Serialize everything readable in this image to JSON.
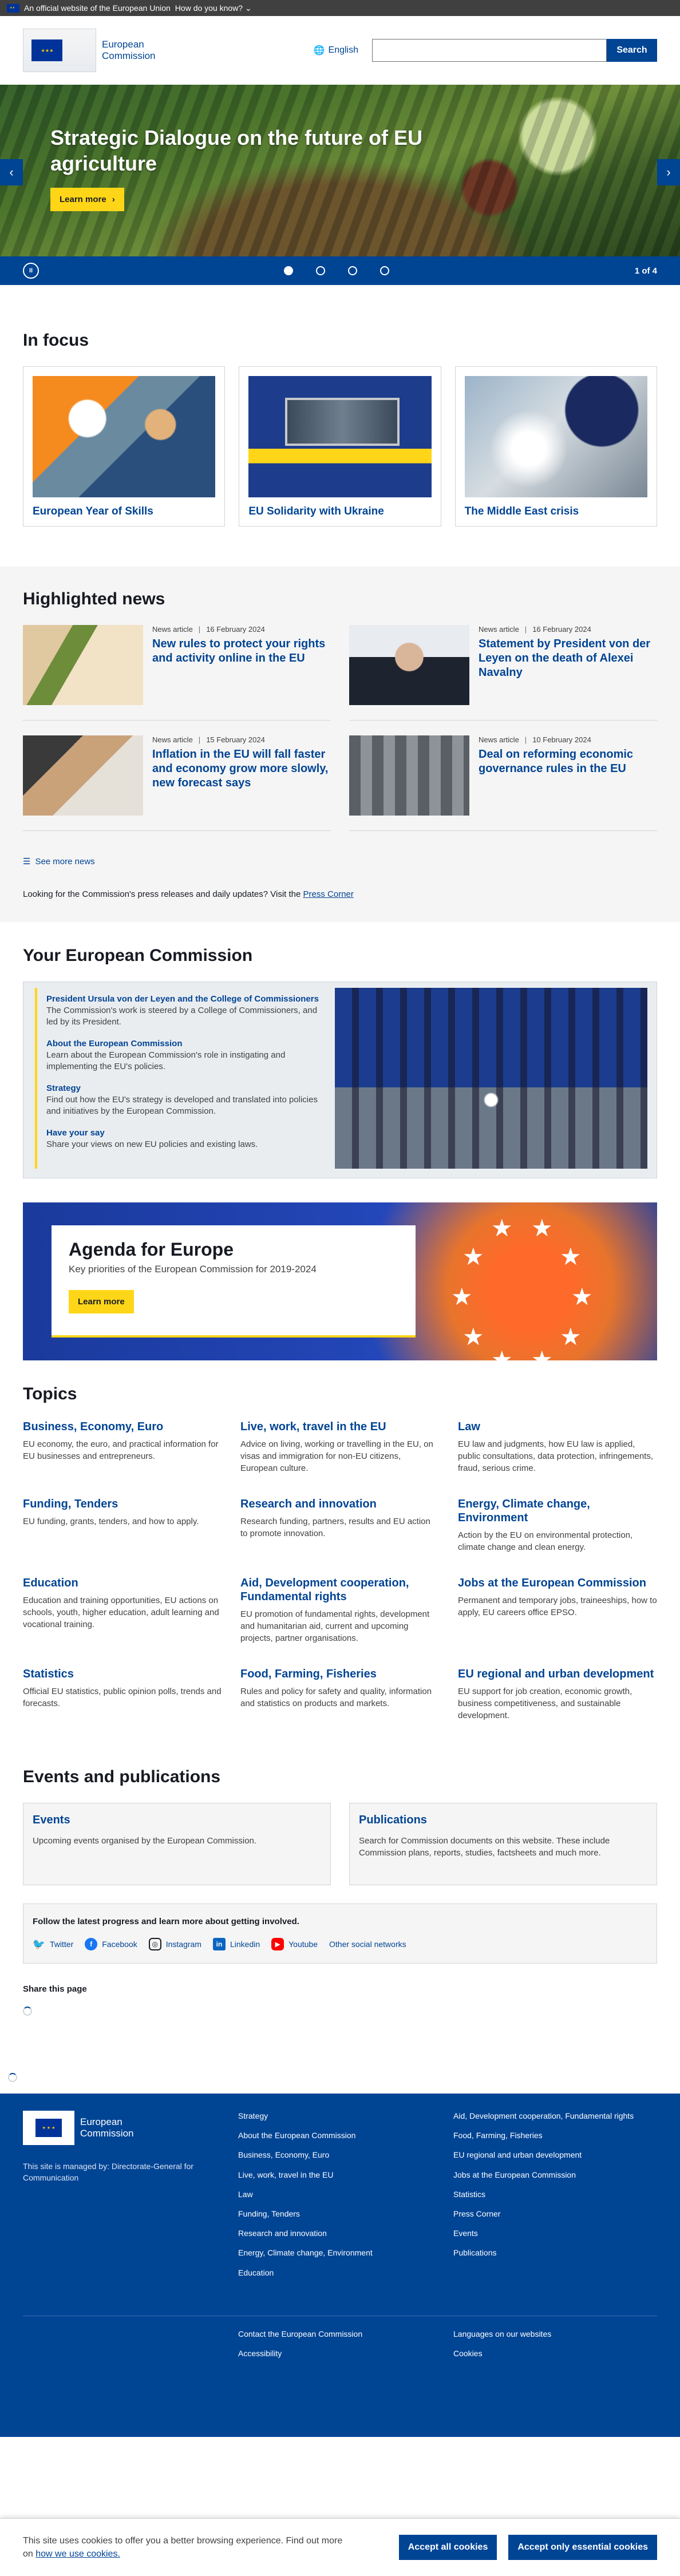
{
  "eu_bar": {
    "text": "An official website of the European Union",
    "dropdown": "How do you know?"
  },
  "header": {
    "logo_line1": "European",
    "logo_line2": "Commission",
    "language": "English",
    "search_placeholder": "",
    "search_button": "Search"
  },
  "hero": {
    "title": "Strategic Dialogue on the future of EU agriculture",
    "button": "Learn more",
    "counter": "1 of 4",
    "pause_label": "II",
    "prev": "‹",
    "next": "›"
  },
  "focus": {
    "title": "In focus",
    "cards": [
      {
        "title": "European Year of Skills"
      },
      {
        "title": "EU Solidarity with Ukraine"
      },
      {
        "title": "The Middle East crisis"
      }
    ]
  },
  "news": {
    "title": "Highlighted news",
    "items": [
      {
        "type": "News article",
        "date": "16 February 2024",
        "title": "New rules to protect your rights and activity online in the EU"
      },
      {
        "type": "News article",
        "date": "16 February 2024",
        "title": "Statement by President von der Leyen on the death of Alexei Navalny"
      },
      {
        "type": "News article",
        "date": "15 February 2024",
        "title": "Inflation in the EU will fall faster and economy grow more slowly, new forecast says"
      },
      {
        "type": "News article",
        "date": "10 February 2024",
        "title": "Deal on reforming economic governance rules in the EU"
      }
    ],
    "see_more": "See more news",
    "press_text": "Looking for the Commission's press releases and daily updates? Visit the",
    "press_link": "Press Corner"
  },
  "your_ec": {
    "title": "Your European Commission",
    "links": [
      {
        "title": "President Ursula von der Leyen and the College of Commissioners",
        "desc": "The Commission's work is steered by a College of Commissioners, and led by its President."
      },
      {
        "title": "About the European Commission",
        "desc": "Learn about the European Commission's role in instigating and implementing the EU's policies."
      },
      {
        "title": "Strategy",
        "desc": "Find out how the EU's strategy is developed and translated into policies and initiatives by the European Commission."
      },
      {
        "title": "Have your say",
        "desc": "Share your views on new EU policies and existing laws."
      }
    ]
  },
  "agenda": {
    "title": "Agenda for Europe",
    "subtitle": "Key priorities of the European Commission for 2019-2024",
    "button": "Learn more"
  },
  "topics": {
    "title": "Topics",
    "items": [
      {
        "title": "Business, Economy, Euro",
        "desc": "EU economy, the euro, and practical information for EU businesses and entrepreneurs."
      },
      {
        "title": "Live, work, travel in the EU",
        "desc": "Advice on living, working or travelling in the EU, on visas and immigration for non-EU citizens, European culture."
      },
      {
        "title": "Law",
        "desc": "EU law and judgments, how EU law is applied, public consultations, data protection, infringements, fraud, serious crime."
      },
      {
        "title": "Funding, Tenders",
        "desc": "EU funding, grants, tenders, and how to apply."
      },
      {
        "title": "Research and innovation",
        "desc": "Research funding, partners, results and EU action to promote innovation."
      },
      {
        "title": "Energy, Climate change, Environment",
        "desc": "Action by the EU on environmental protection, climate change and clean energy."
      },
      {
        "title": "Education",
        "desc": "Education and training opportunities, EU actions on schools, youth, higher education, adult learning and vocational training."
      },
      {
        "title": "Aid, Development cooperation, Fundamental rights",
        "desc": "EU promotion of fundamental rights, development and humanitarian aid, current and upcoming projects, partner organisations."
      },
      {
        "title": "Jobs at the European Commission",
        "desc": "Permanent and temporary jobs, traineeships, how to apply, EU careers office EPSO."
      },
      {
        "title": "Statistics",
        "desc": "Official EU statistics, public opinion polls, trends and forecasts."
      },
      {
        "title": "Food, Farming, Fisheries",
        "desc": "Rules and policy for safety and quality, information and statistics on products and markets."
      },
      {
        "title": "EU regional and urban development",
        "desc": "EU support for job creation, economic growth, business competitiveness, and sustainable development."
      }
    ]
  },
  "events": {
    "title": "Events and publications",
    "cards": [
      {
        "title": "Events",
        "desc": "Upcoming events organised by the European Commission."
      },
      {
        "title": "Publications",
        "desc": "Search for Commission documents on this website. These include Commission plans, reports, studies, factsheets and much more."
      }
    ]
  },
  "social": {
    "title": "Follow the latest progress and learn more about getting involved.",
    "links": [
      "Twitter",
      "Facebook",
      "Instagram",
      "Linkedin",
      "Youtube",
      "Other social networks"
    ]
  },
  "share_title": "Share this page",
  "footer": {
    "logo_line1": "European",
    "logo_line2": "Commission",
    "managed": "This site is managed by: Directorate-General for Communication",
    "col2": [
      "Strategy",
      "About the European Commission",
      "Business, Economy, Euro",
      "Live, work, travel in the EU",
      "Law",
      "Funding, Tenders",
      "Research and innovation",
      "Energy, Climate change, Environment",
      "Education"
    ],
    "col3": [
      "Aid, Development cooperation, Fundamental rights",
      "Food, Farming, Fisheries",
      "EU regional and urban development",
      "Jobs at the European Commission",
      "Statistics",
      "Press Corner",
      "Events",
      "Publications"
    ],
    "bottom_col2": [
      "Contact the European Commission",
      "Accessibility"
    ],
    "bottom_col3": [
      "Languages on our websites",
      "Cookies"
    ]
  },
  "cookie": {
    "text": "This site uses cookies to offer you a better browsing experience. Find out more on",
    "link": "how we use cookies.",
    "accept_all": "Accept all cookies",
    "accept_essential": "Accept only essential cookies"
  },
  "colors": {
    "primary": "#004494",
    "accent": "#ffd617",
    "text": "#171a22"
  }
}
